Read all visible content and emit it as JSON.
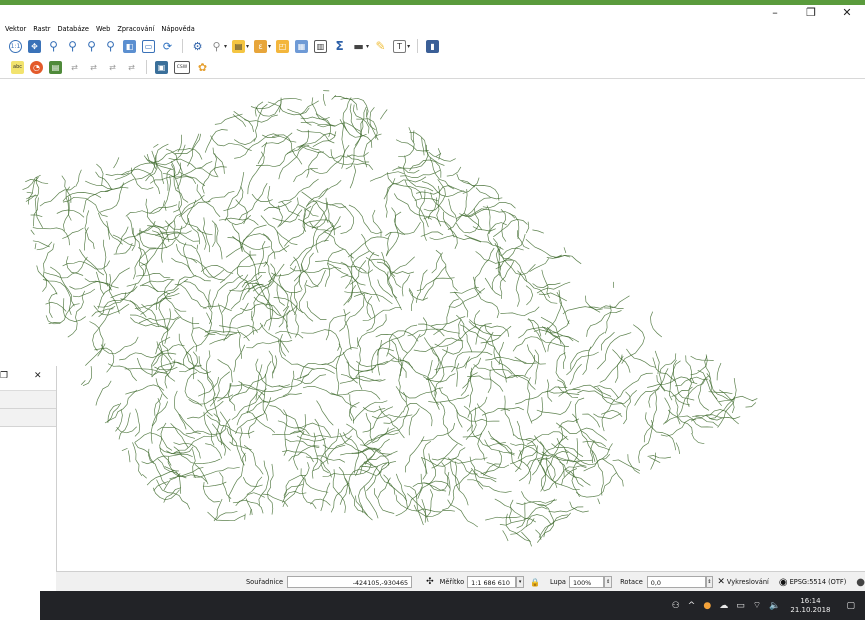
{
  "window": {
    "minimize_label": "–",
    "restore_label": "❐",
    "close_label": "✕"
  },
  "menu": {
    "items": [
      "Vektor",
      "Rastr",
      "Databáze",
      "Web",
      "Zpracování",
      "Nápověda"
    ]
  },
  "toolbar": {
    "sigma_label": "Σ",
    "csw_label": "CSW",
    "abc_label": "abc"
  },
  "map": {
    "river_color": "#3f6b2e",
    "description_icons": [
      "rivers-network"
    ]
  },
  "panel": {
    "restore_label": "❐",
    "close_label": "✕"
  },
  "statusbar": {
    "coords_label": "Souřadnice",
    "coords_value": "-424105,-930465",
    "scale_label": "Měřítko",
    "scale_value": "1:1 686 610",
    "magnifier_label": "Lupa",
    "magnifier_value": "100%",
    "rotation_label": "Rotace",
    "rotation_value": "0,0",
    "render_label": "Vykreslování",
    "crs_label": "EPSG:5514 (OTF)"
  },
  "taskbar": {
    "time": "16:14",
    "date": "21.10.2018"
  },
  "colors": {
    "accent_green": "#5a9b3c",
    "taskbar_bg": "#222327",
    "statusbar_bg": "#f0f0f0"
  }
}
